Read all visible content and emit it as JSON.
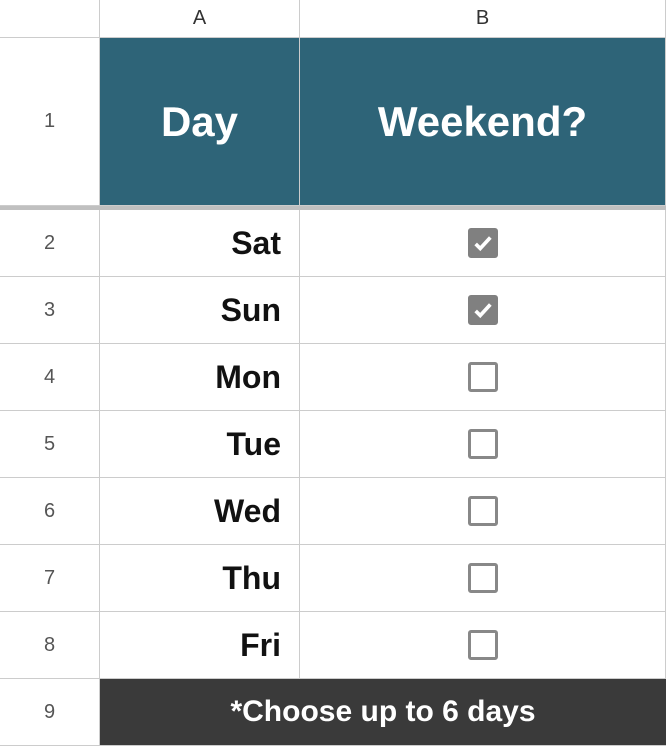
{
  "columns": [
    "A",
    "B"
  ],
  "rows": [
    "1",
    "2",
    "3",
    "4",
    "5",
    "6",
    "7",
    "8",
    "9"
  ],
  "headers": {
    "col_a": "Day",
    "col_b": "Weekend?"
  },
  "days": [
    {
      "label": "Sat",
      "checked": true
    },
    {
      "label": "Sun",
      "checked": true
    },
    {
      "label": "Mon",
      "checked": false
    },
    {
      "label": "Tue",
      "checked": false
    },
    {
      "label": "Wed",
      "checked": false
    },
    {
      "label": "Thu",
      "checked": false
    },
    {
      "label": "Fri",
      "checked": false
    }
  ],
  "footer": "*Choose up to 6 days",
  "colors": {
    "header_bg": "#2e6478",
    "footer_bg": "#3a3a3a"
  }
}
